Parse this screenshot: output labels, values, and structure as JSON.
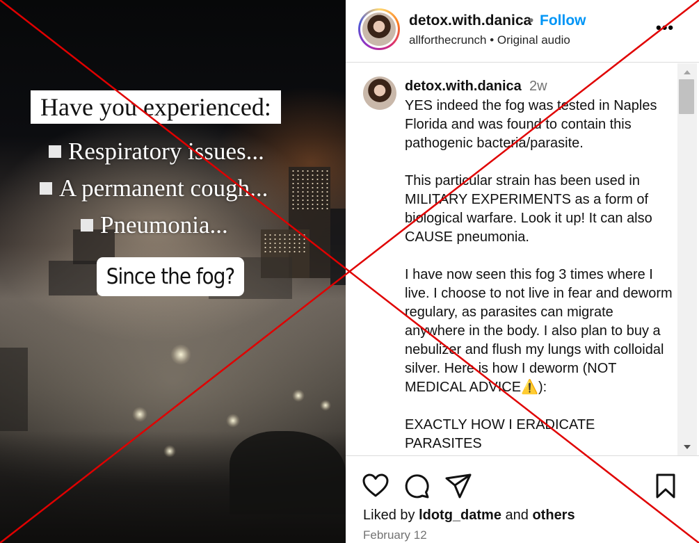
{
  "media": {
    "title_card": "Have you experienced:",
    "bullets": [
      "Respiratory issues...",
      "A permanent cough...",
      "Pneumonia..."
    ],
    "sticker": "Since the fog?"
  },
  "header": {
    "username": "detox.with.danica",
    "separator": "•",
    "follow_label": "Follow",
    "subtitle": "allforthecrunch • Original audio",
    "more_label": "•••"
  },
  "comment": {
    "username": "detox.with.danica",
    "time": "2w",
    "text": "YES indeed the fog was tested in Naples Florida and was found to contain this pathogenic bacteria/parasite.\n\nThis particular strain has been used in MILITARY EXPERIMENTS as a form of biological warfare. Look it up! It can also CAUSE pneumonia.\n\nI have now seen this fog 3 times where I live. I choose to not live in fear and deworm regulary, as parasites can migrate anywhere in the body. I also plan to buy a nebulizer and flush my lungs with colloidal silver. Here is how I deworm (NOT MEDICAL ADVICE⚠️):\n\nEXACTLY HOW I ERADICATE PARASITES"
  },
  "footer": {
    "liked_prefix": "Liked by",
    "liked_user": "ldotg_datme",
    "liked_and": "and",
    "liked_others": "others",
    "date": "February 12"
  },
  "icons": [
    "heart-icon",
    "comment-icon",
    "share-icon",
    "bookmark-icon",
    "more-options-icon"
  ],
  "colors": {
    "follow": "#0095f6",
    "x_mark": "#e00000",
    "muted": "#737373"
  }
}
